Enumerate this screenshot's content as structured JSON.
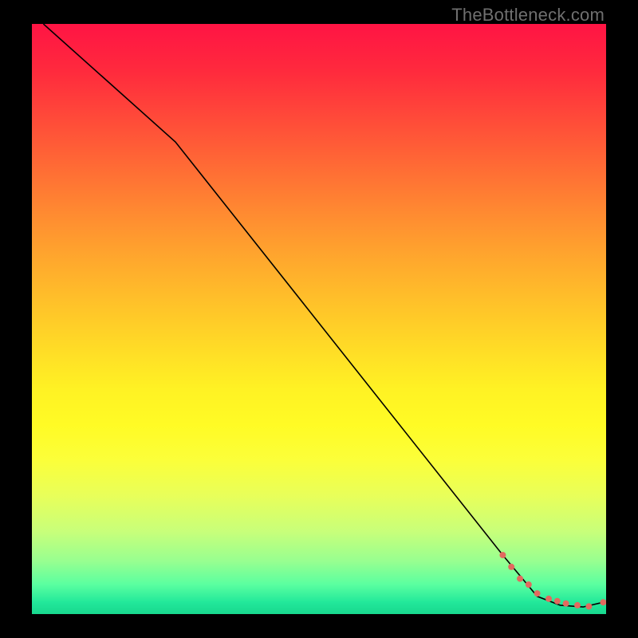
{
  "brand": "TheBottleneck.com",
  "colors": {
    "background": "#000000",
    "brand_text": "#6f6f6f",
    "curve": "#000000",
    "marker": "#e26a5f"
  },
  "chart_data": {
    "type": "line",
    "title": "",
    "xlabel": "",
    "ylabel": "",
    "xlim": [
      0,
      100
    ],
    "ylim": [
      0,
      100
    ],
    "series": [
      {
        "name": "bottleneck-curve",
        "x": [
          2,
          25,
          82,
          88,
          92,
          96,
          99.5
        ],
        "y": [
          100,
          80,
          10,
          3,
          1.5,
          1.2,
          2
        ]
      }
    ],
    "markers": {
      "name": "data-points",
      "x": [
        82,
        83.5,
        85,
        86.5,
        88,
        90,
        91.5,
        93,
        95,
        97,
        99.5
      ],
      "y": [
        10,
        8,
        6,
        5,
        3.5,
        2.6,
        2.2,
        1.8,
        1.5,
        1.3,
        2
      ],
      "r": 4
    }
  }
}
